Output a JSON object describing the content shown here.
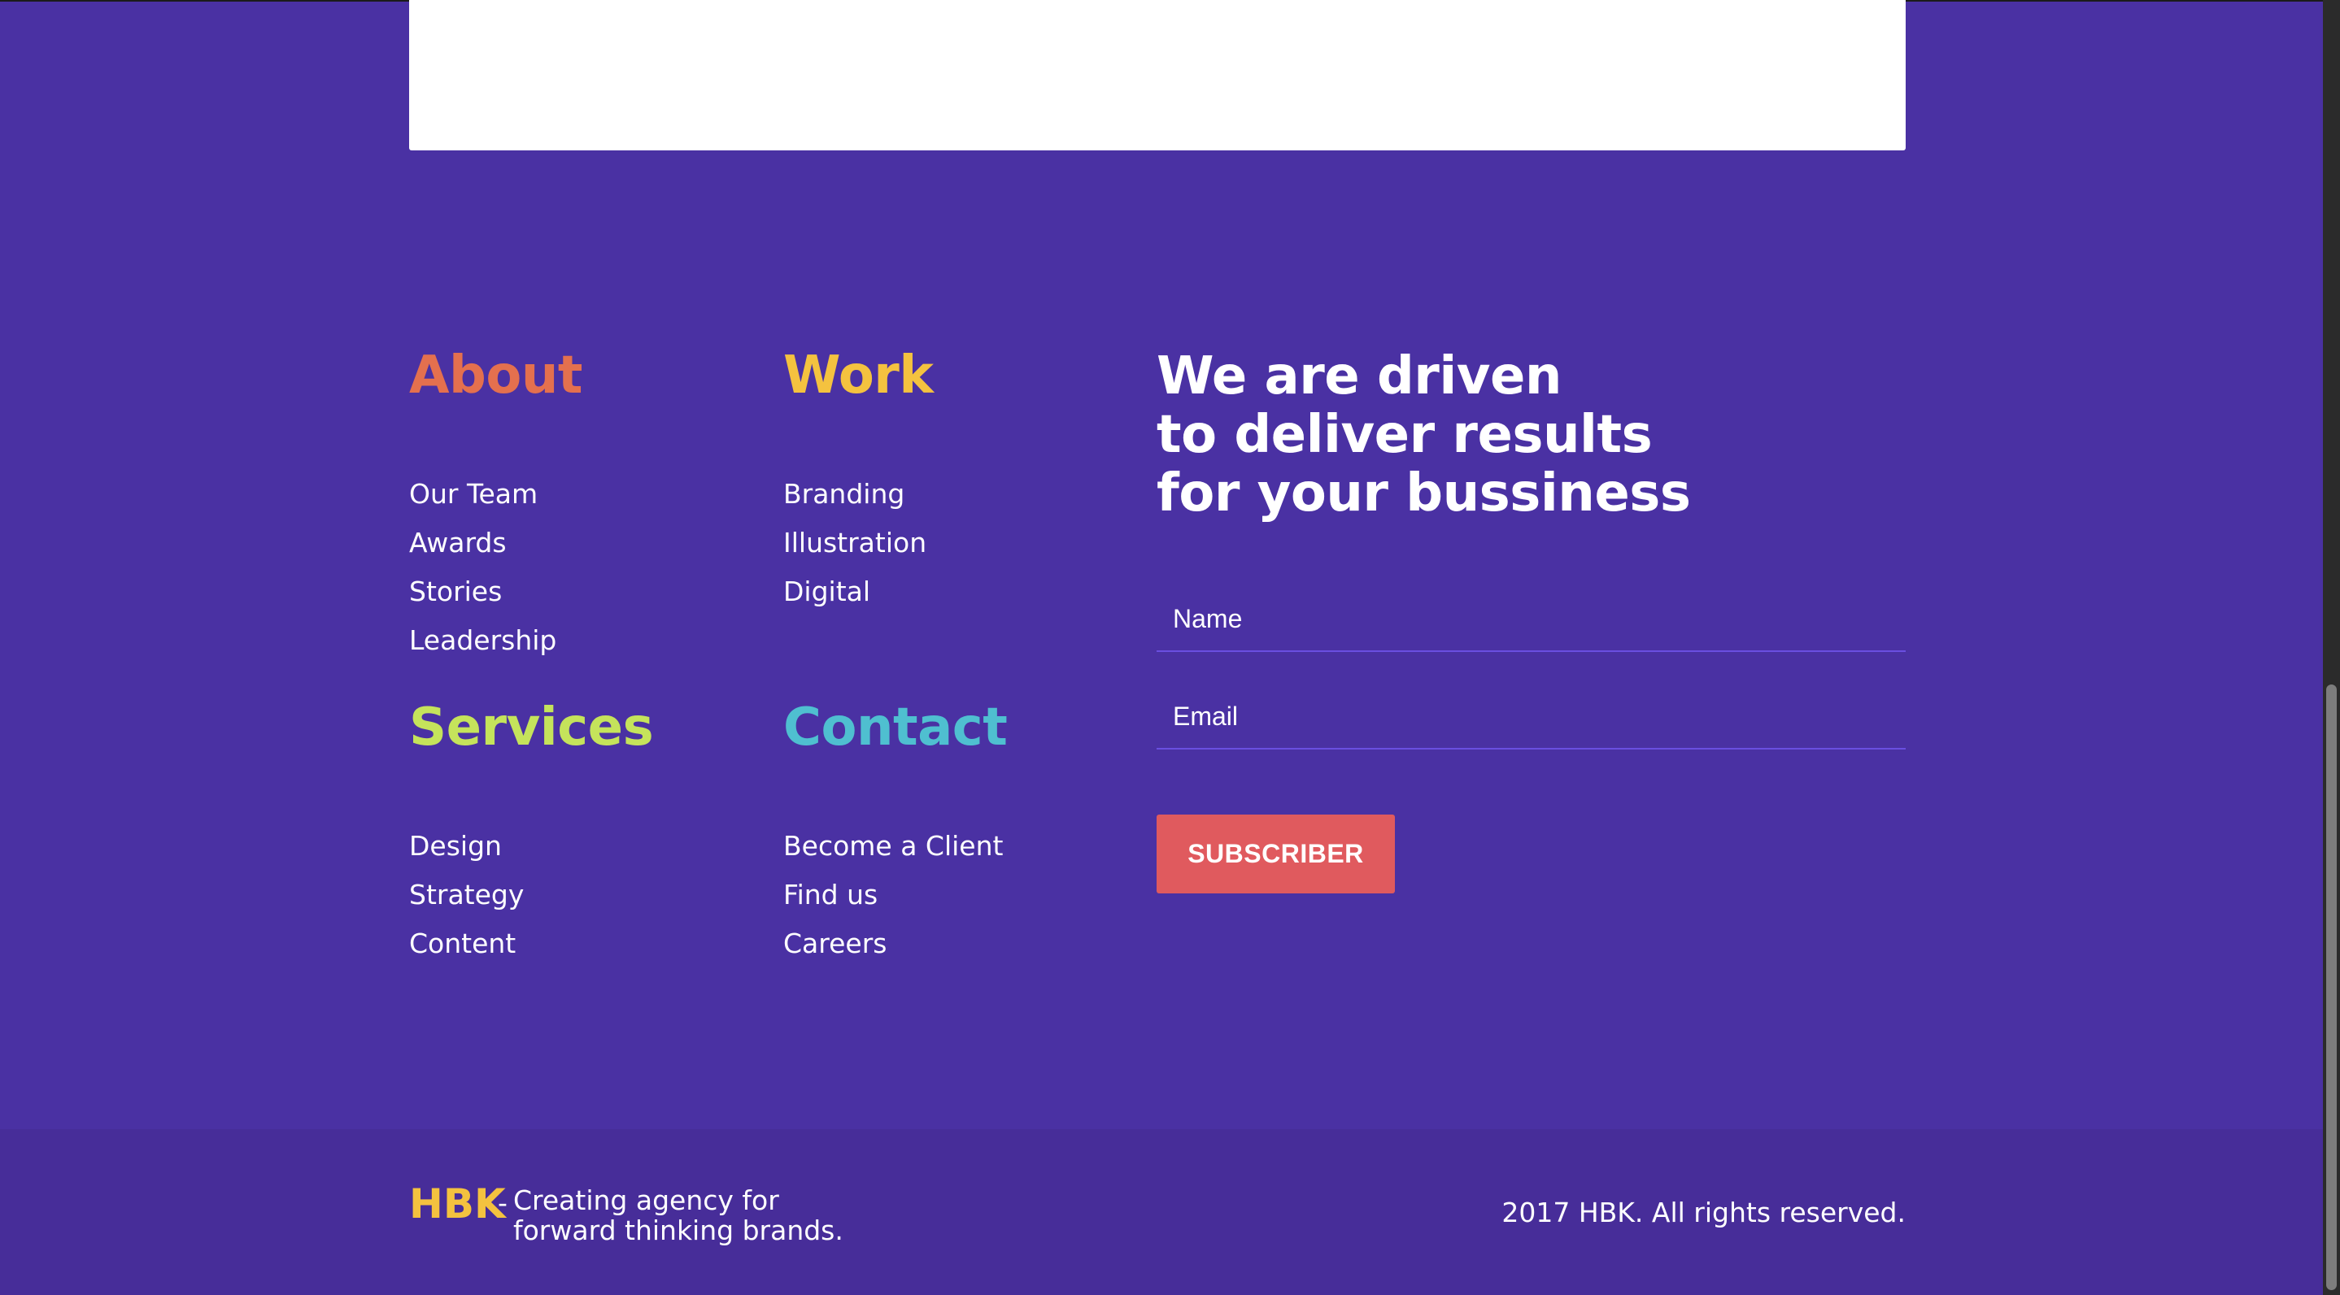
{
  "colors": {
    "background": "#4a31a3",
    "footer_bar": "#472d99",
    "about_heading": "#e4704e",
    "work_heading": "#f4c23f",
    "services_heading": "#c5e35b",
    "contact_heading": "#4fbfd0",
    "subscribe_button": "#e05a5e",
    "brand": "#f4c23f"
  },
  "about": {
    "title": "About",
    "items": [
      "Our Team",
      "Awards",
      "Stories",
      "Leadership"
    ]
  },
  "work": {
    "title": "Work",
    "items": [
      "Branding",
      "Illustration",
      "Digital"
    ]
  },
  "services": {
    "title": "Services",
    "items": [
      "Design",
      "Strategy",
      "Content"
    ]
  },
  "contact": {
    "title": "Contact",
    "items": [
      "Become a Client",
      "Find us",
      "Careers"
    ]
  },
  "newsletter": {
    "tagline": [
      "We are driven",
      "to deliver results",
      "for your bussiness"
    ],
    "name_placeholder": "Name",
    "email_placeholder": "Email",
    "button_label": "SUBSCRIBER"
  },
  "footer": {
    "brand": "HBK",
    "separator": "-",
    "description": "Creating agency for forward thinking brands.",
    "copyright": "2017 HBK. All rights reserved."
  }
}
